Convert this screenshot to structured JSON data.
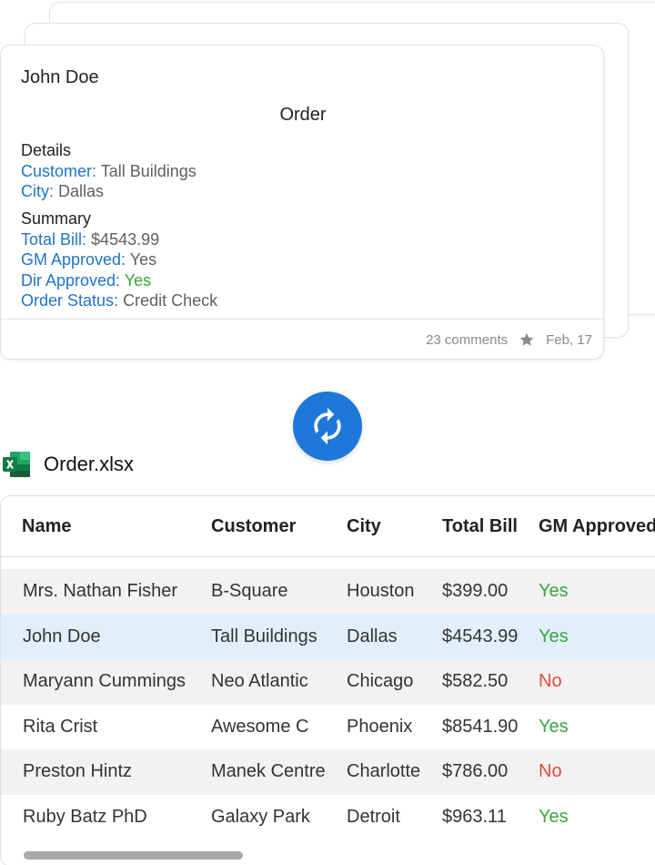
{
  "card": {
    "author": "John Doe",
    "title": "Order",
    "details": {
      "heading": "Details",
      "fields": [
        {
          "label": "Customer:",
          "value": "Tall Buildings"
        },
        {
          "label": "City:",
          "value": "Dallas"
        }
      ]
    },
    "summary": {
      "heading": "Summary",
      "fields": [
        {
          "label": "Total Bill:",
          "value": "$4543.99"
        },
        {
          "label": "GM Approved:",
          "value": "Yes"
        },
        {
          "label": "Dir Approved:",
          "value": "Yes"
        },
        {
          "label": "Order Status:",
          "value": "Credit Check"
        }
      ]
    },
    "footer": {
      "comments": "23 comments",
      "date": "Feb, 17",
      "star_icon": "star-icon"
    }
  },
  "sync_button": {
    "icon": "sync-icon",
    "color": "#1f78d9"
  },
  "file": {
    "name": "Order.xlsx",
    "icon": "excel-icon"
  },
  "table": {
    "columns": [
      "Name",
      "Customer",
      "City",
      "Total Bill",
      "GM Approved"
    ],
    "rows": [
      {
        "name": "Mrs. Nathan Fisher",
        "customer": "B-Square",
        "city": "Houston",
        "total_bill": "$399.00",
        "gm_approved": "Yes"
      },
      {
        "name": "John Doe",
        "customer": "Tall Buildings",
        "city": "Dallas",
        "total_bill": "$4543.99",
        "gm_approved": "Yes"
      },
      {
        "name": "Maryann Cummings",
        "customer": "Neo Atlantic",
        "city": "Chicago",
        "total_bill": "$582.50",
        "gm_approved": "No"
      },
      {
        "name": "Rita Crist",
        "customer": "Awesome C",
        "city": "Phoenix",
        "total_bill": "$8541.90",
        "gm_approved": "Yes"
      },
      {
        "name": "Preston Hintz",
        "customer": "Manek Centre",
        "city": "Charlotte",
        "total_bill": "$786.00",
        "gm_approved": "No"
      },
      {
        "name": "Ruby Batz PhD",
        "customer": "Galaxy Park",
        "city": "Detroit",
        "total_bill": "$963.11",
        "gm_approved": "Yes"
      }
    ]
  },
  "colors": {
    "label_blue": "#1f74c9",
    "yes_green": "#3aa53f",
    "no_red": "#e04b3b",
    "selected_row": "#e3eefb"
  }
}
